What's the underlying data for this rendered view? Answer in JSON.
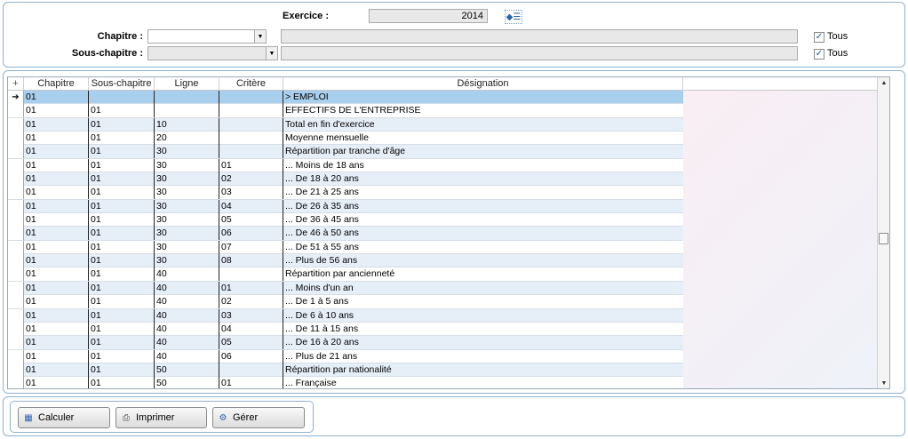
{
  "filters": {
    "exercice_label": "Exercice :",
    "exercice_value": "2014",
    "chapitre_label": "Chapitre :",
    "chapitre_value": "",
    "sous_chapitre_label": "Sous-chapitre :",
    "sous_chapitre_value": "",
    "tous_label_1": "Tous",
    "tous_label_2": "Tous",
    "tous_1_checked": true,
    "tous_2_checked": true
  },
  "grid": {
    "columns": [
      "Chapitre",
      "Sous-chapitre",
      "Ligne",
      "Critère",
      "Désignation"
    ],
    "corner_icon": "add-column-icon",
    "selected_row_indicator": "➔",
    "rows": [
      [
        "01",
        "",
        "",
        "",
        "> EMPLOI"
      ],
      [
        "01",
        "01",
        "",
        "",
        "EFFECTIFS DE L'ENTREPRISE"
      ],
      [
        "01",
        "01",
        "10",
        "",
        "Total en fin d'exercice"
      ],
      [
        "01",
        "01",
        "20",
        "",
        "Moyenne mensuelle"
      ],
      [
        "01",
        "01",
        "30",
        "",
        "Répartition par tranche d'âge"
      ],
      [
        "01",
        "01",
        "30",
        "01",
        "... Moins de 18 ans"
      ],
      [
        "01",
        "01",
        "30",
        "02",
        "... De 18 à 20 ans"
      ],
      [
        "01",
        "01",
        "30",
        "03",
        "... De 21 à 25 ans"
      ],
      [
        "01",
        "01",
        "30",
        "04",
        "... De 26 à 35 ans"
      ],
      [
        "01",
        "01",
        "30",
        "05",
        "... De 36 à 45 ans"
      ],
      [
        "01",
        "01",
        "30",
        "06",
        "... De 46 à 50 ans"
      ],
      [
        "01",
        "01",
        "30",
        "07",
        "... De 51 à 55 ans"
      ],
      [
        "01",
        "01",
        "30",
        "08",
        "... Plus de 56 ans"
      ],
      [
        "01",
        "01",
        "40",
        "",
        "Répartition par ancienneté"
      ],
      [
        "01",
        "01",
        "40",
        "01",
        "... Moins d'un an"
      ],
      [
        "01",
        "01",
        "40",
        "02",
        "... De 1 à 5 ans"
      ],
      [
        "01",
        "01",
        "40",
        "03",
        "... De 6 à 10 ans"
      ],
      [
        "01",
        "01",
        "40",
        "04",
        "... De 11 à 15 ans"
      ],
      [
        "01",
        "01",
        "40",
        "05",
        "... De 16 à 20 ans"
      ],
      [
        "01",
        "01",
        "40",
        "06",
        "... Plus de 21 ans"
      ],
      [
        "01",
        "01",
        "50",
        "",
        "Répartition par nationalité"
      ],
      [
        "01",
        "01",
        "50",
        "01",
        "... Française"
      ]
    ]
  },
  "buttons": {
    "calculer": "Calculer",
    "imprimer": "Imprimer",
    "gerer": "Gérer"
  }
}
